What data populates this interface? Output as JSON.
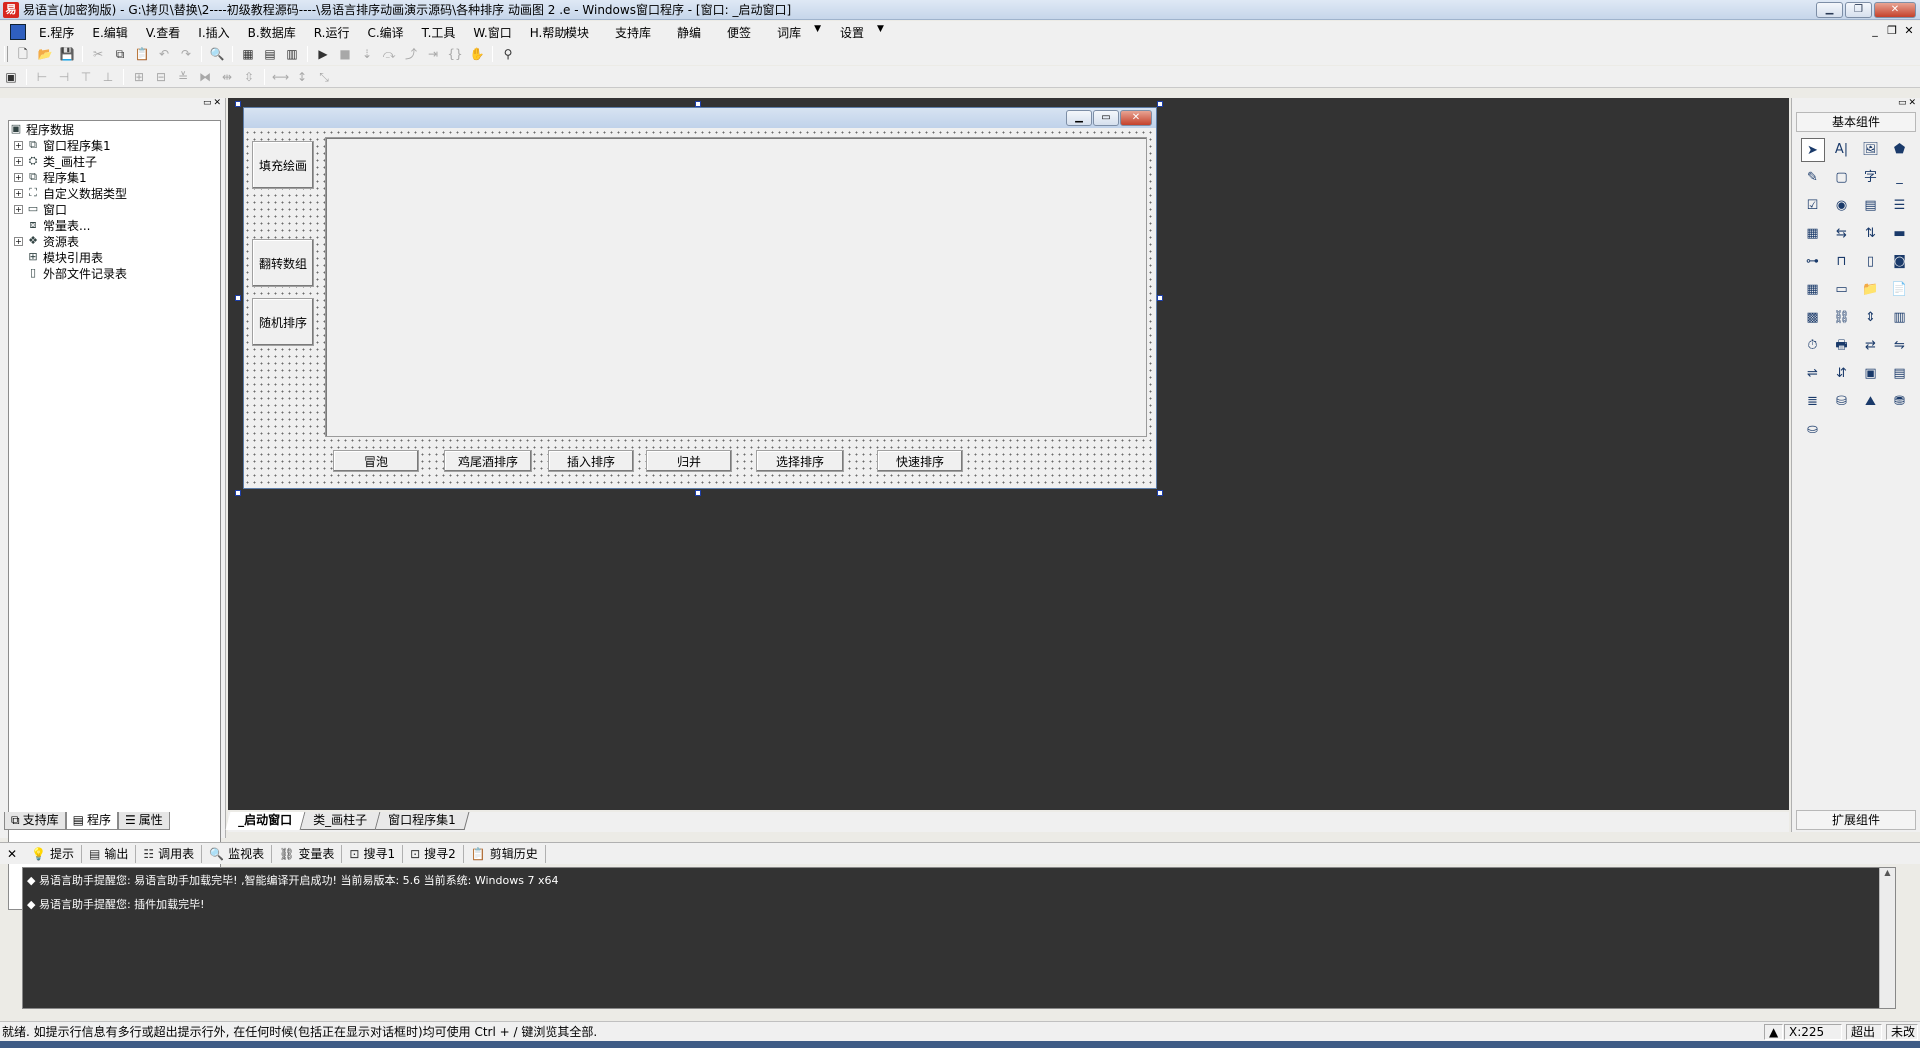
{
  "window": {
    "title": "易语言(加密狗版) - G:\\拷贝\\替换\\2----初级教程源码----\\易语言排序动画演示源码\\各种排序 动画图 2 .e - Windows窗口程序 - [窗口: _启动窗口]",
    "icon_text": "易"
  },
  "menubar": {
    "items": [
      "E.程序",
      "E.编辑",
      "V.查看",
      "I.插入",
      "B.数据库",
      "R.运行",
      "C.编译",
      "T.工具",
      "W.窗口",
      "H.帮助"
    ],
    "right_items": [
      "模块",
      "支持库",
      "静编",
      "便签",
      "词库",
      "设置"
    ]
  },
  "left_panel": {
    "tree": [
      {
        "label": "程序数据",
        "icon": "folder-icon",
        "expand": "",
        "level": 0
      },
      {
        "label": "窗口程序集1",
        "icon": "stack-icon",
        "expand": "+",
        "level": 1
      },
      {
        "label": "类_画柱子",
        "icon": "class-icon",
        "expand": "+",
        "level": 1
      },
      {
        "label": "程序集1",
        "icon": "stack-icon",
        "expand": "+",
        "level": 1
      },
      {
        "label": "自定义数据类型",
        "icon": "datatype-icon",
        "expand": "+",
        "level": 1
      },
      {
        "label": "窗口",
        "icon": "window-icon",
        "expand": "+",
        "level": 1
      },
      {
        "label": "常量表...",
        "icon": "constant-icon",
        "expand": "",
        "level": 1
      },
      {
        "label": "资源表",
        "icon": "resource-icon",
        "expand": "+",
        "level": 1
      },
      {
        "label": "模块引用表",
        "icon": "module-icon",
        "expand": "",
        "level": 1
      },
      {
        "label": "外部文件记录表",
        "icon": "file-icon",
        "expand": "",
        "level": 1
      }
    ],
    "tabs": [
      "支持库",
      "程序",
      "属性"
    ]
  },
  "form": {
    "side_buttons": [
      "填充绘画",
      "翻转数组",
      "随机排序"
    ],
    "bottom_buttons": [
      "冒泡",
      "鸡尾酒排序",
      "插入排序",
      "归并",
      "选择排序",
      "快速排序"
    ]
  },
  "doc_tabs": [
    "_启动窗口",
    "类_画柱子",
    "窗口程序集1"
  ],
  "toolbox": {
    "header": "基本组件",
    "footer": "扩展组件"
  },
  "output_tabs": [
    "提示",
    "输出",
    "调用表",
    "监视表",
    "变量表",
    "搜寻1",
    "搜寻2",
    "剪辑历史"
  ],
  "output_lines": [
    "◆ 易语言助手提醒您: 易语言助手加载完毕! ,智能编译开启成功! 当前易版本: 5.6 当前系统: Windows 7 x64",
    "◆ 易语言助手提醒您: 插件加载完毕!"
  ],
  "statusbar": {
    "text": "就绪. 如提示行信息有多行或超出提示行外, 在任何时候(包括正在显示对话框时)均可使用 Ctrl + / 键浏览其全部.",
    "coord": "X:225",
    "mode": "超出",
    "saved": "未改"
  },
  "colors": {
    "designer_bg": "#333333",
    "form_border": "#5d7da8",
    "selection_handle": "#1d3ea7"
  }
}
